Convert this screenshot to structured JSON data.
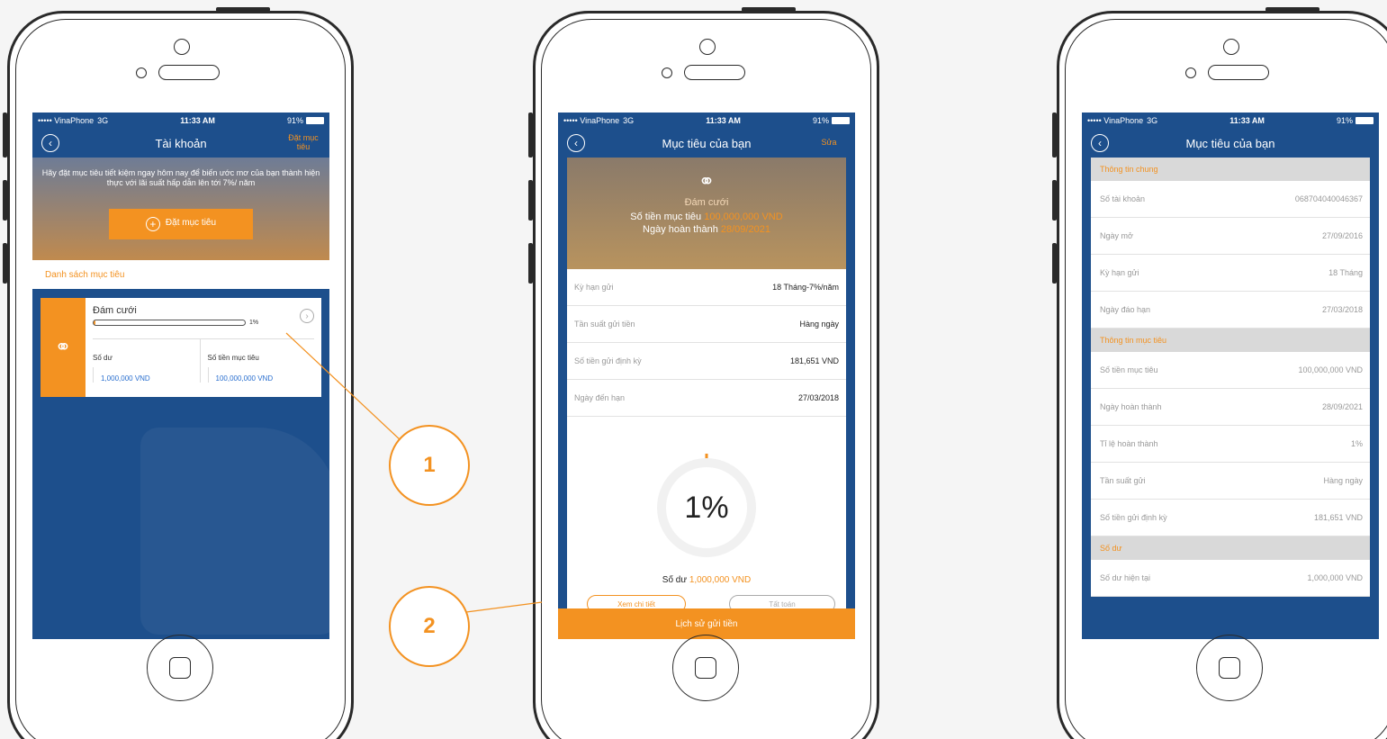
{
  "status": {
    "signal": "••••• VinaPhone",
    "net": "3G",
    "time": "11:33 AM",
    "battery": "91%"
  },
  "screen1": {
    "title": "Tài khoản",
    "right_action": "Đặt mục tiêu",
    "promo_text": "Hãy đặt mục tiêu tiết kiệm ngay hôm nay để biến ước mơ của bạn thành hiện thực với lãi suất hấp dẫn lên tới 7%/ năm",
    "cta": "Đặt mục tiêu",
    "list_title": "Danh sách mục tiêu",
    "goal": {
      "name": "Đám cưới",
      "progress": 1,
      "progress_label": "1%",
      "balance_label": "Số dư",
      "balance_value": "1,000,000 VND",
      "target_label": "Số tiền mục tiêu",
      "target_value": "100,000,000 VND"
    }
  },
  "screen2": {
    "title": "Mục tiêu của bạn",
    "right_action": "Sửa",
    "goal_name": "Đám cưới",
    "target_label": "Số tiền mục tiêu",
    "target_value": "100,000,000 VND",
    "finish_label": "Ngày hoàn thành",
    "finish_value": "28/09/2021",
    "rows": [
      {
        "k": "Kỳ hạn gửi",
        "v": "18 Tháng-7%/năm"
      },
      {
        "k": "Tần suất gửi tiền",
        "v": "Hàng ngày"
      },
      {
        "k": "Số tiền gửi định kỳ",
        "v": "181,651 VND"
      },
      {
        "k": "Ngày đến hạn",
        "v": "27/03/2018"
      }
    ],
    "percent": "1%",
    "balance_label": "Số dư",
    "balance_value": "1,000,000 VND",
    "btn_detail": "Xem chi tiết",
    "btn_settle": "Tất toán",
    "footer": "Lịch sử gửi tiền"
  },
  "screen3": {
    "title": "Mục tiêu của bạn",
    "section_general": "Thông tin chung",
    "general": [
      {
        "k": "Số tài khoản",
        "v": "068704040046367"
      },
      {
        "k": "Ngày mở",
        "v": "27/09/2016"
      },
      {
        "k": "Kỳ hạn gửi",
        "v": "18 Tháng"
      },
      {
        "k": "Ngày đáo hạn",
        "v": "27/03/2018"
      }
    ],
    "section_goal": "Thông tin mục tiêu",
    "goal": [
      {
        "k": "Số tiền mục tiêu",
        "v": "100,000,000 VND"
      },
      {
        "k": "Ngày hoàn thành",
        "v": "28/09/2021"
      },
      {
        "k": "Tỉ lệ hoàn thành",
        "v": "1%"
      },
      {
        "k": "Tần suất gửi",
        "v": "Hàng ngày"
      },
      {
        "k": "Số tiền gửi định kỳ",
        "v": "181,651 VND"
      }
    ],
    "section_balance": "Số dư",
    "balance": [
      {
        "k": "Số dư hiện tại",
        "v": "1,000,000 VND"
      }
    ]
  },
  "callouts": {
    "one": "1",
    "two": "2"
  },
  "colors": {
    "brand_blue": "#1d4f8c",
    "accent_orange": "#f39221"
  },
  "icons": {
    "back": "back-circle-icon",
    "plus": "plus-circle-icon",
    "rings": "wedding-rings-icon",
    "chevron": "chevron-right-icon"
  }
}
